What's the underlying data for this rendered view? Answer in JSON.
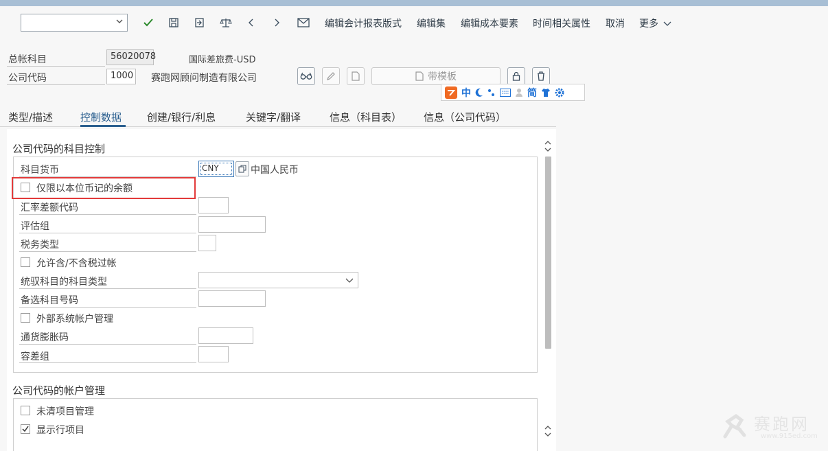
{
  "toolbar": {
    "combo_value": "",
    "actions": [
      "编辑会计报表版式",
      "编辑集",
      "编辑成本要素",
      "时间相关属性",
      "取消",
      "更多"
    ]
  },
  "header": {
    "gl_account_label": "总帐科目",
    "gl_account_value": "56020078",
    "gl_account_desc": "国际差旅费-USD",
    "company_code_label": "公司代码",
    "company_code_value": "1000",
    "company_code_desc": "赛跑网顾问制造有限公司",
    "template_label": "带模板"
  },
  "ime": {
    "zhong": "中",
    "jian": "简"
  },
  "tabs": [
    "类型/描述",
    "控制数据",
    "创建/银行/利息",
    "关键字/翻译",
    "信息（科目表）",
    "信息（公司代码）"
  ],
  "section1": {
    "title": "公司代码的科目控制",
    "account_currency_label": "科目货币",
    "account_currency_value": "CNY",
    "account_currency_desc": "中国人民币",
    "only_local_currency_label": "仅限以本位币记的余额",
    "exchange_diff_label": "汇率差额代码",
    "valuation_group_label": "评估组",
    "tax_category_label": "税务类型",
    "allow_tax_posting_label": "允许含/不含税过帐",
    "recon_account_label": "统驭科目的科目类型",
    "alt_account_label": "备选科目号码",
    "external_mgmt_label": "外部系统帐户管理",
    "inflation_key_label": "通货膨胀码",
    "tolerance_group_label": "容差组"
  },
  "section2": {
    "title": "公司代码的帐户管理",
    "open_item_label": "未清项目管理",
    "line_items_label": "显示行项目",
    "line_items_checked": true
  },
  "watermark": {
    "logo_text": "赛跑网",
    "url": "www.915ed.com"
  }
}
